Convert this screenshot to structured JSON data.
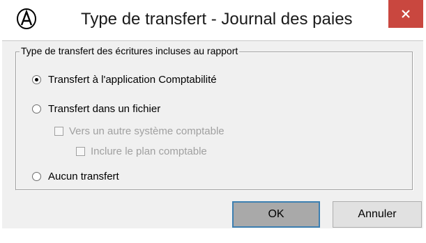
{
  "window": {
    "title": "Type de transfert - Journal des paies",
    "app_icon": "accounting-app-icon",
    "close_icon": "close-icon",
    "close_color": "#c9473f"
  },
  "group": {
    "legend": "Type de transfert des écritures incluses au rapport",
    "options": [
      {
        "label": "Transfert à l'application Comptabilité",
        "type": "radio",
        "checked": true,
        "enabled": true
      },
      {
        "label": "Transfert dans un fichier",
        "type": "radio",
        "checked": false,
        "enabled": true
      },
      {
        "label": "Vers un autre système comptable",
        "type": "checkbox",
        "checked": false,
        "enabled": false
      },
      {
        "label": "Inclure le plan comptable",
        "type": "checkbox",
        "checked": false,
        "enabled": false
      },
      {
        "label": "Aucun transfert",
        "type": "radio",
        "checked": false,
        "enabled": true
      }
    ]
  },
  "buttons": {
    "ok": "OK",
    "cancel": "Annuler"
  }
}
